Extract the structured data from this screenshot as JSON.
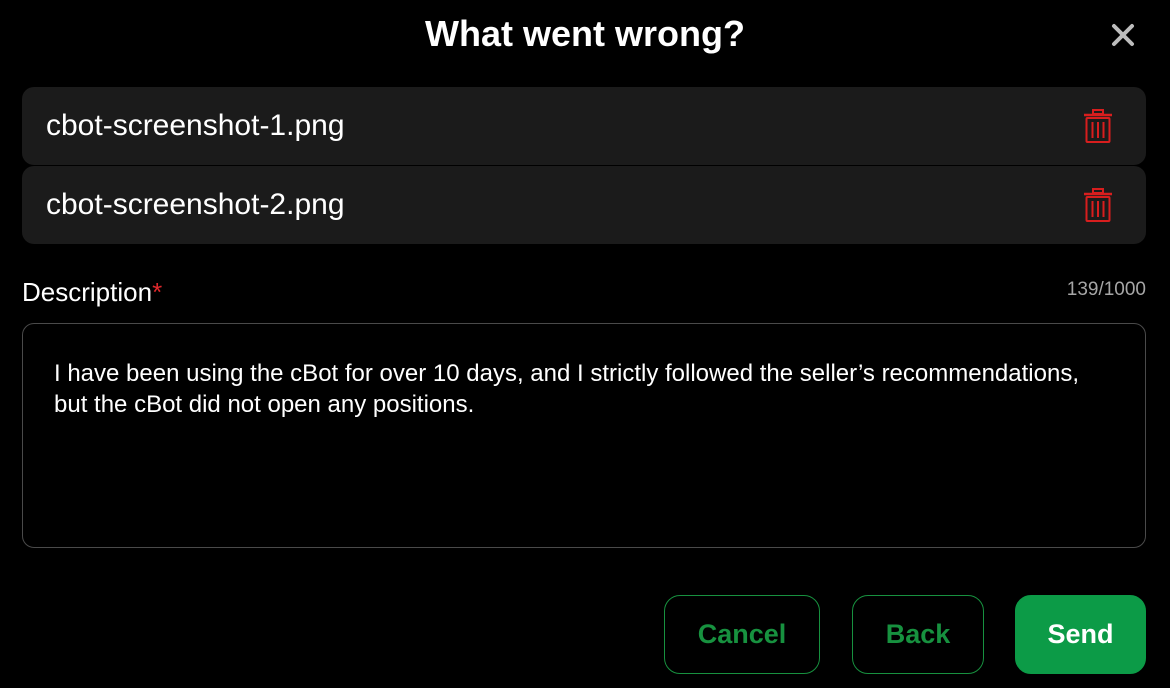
{
  "dialog": {
    "title": "What went wrong?",
    "close_icon": "close-icon"
  },
  "attachments": [
    {
      "file_name": "cbot-screenshot-1.png",
      "delete_icon": "trash-icon"
    },
    {
      "file_name": "cbot-screenshot-2.png",
      "delete_icon": "trash-icon"
    }
  ],
  "description": {
    "label": "Description",
    "required_marker": "*",
    "counter": "139/1000",
    "value": "I have been using the cBot for over 10 days, and I strictly followed the seller’s recommendations, but the cBot did not open any positions."
  },
  "actions": {
    "cancel_label": "Cancel",
    "back_label": "Back",
    "send_label": "Send"
  },
  "colors": {
    "background": "#000000",
    "row_background": "#1b1b1b",
    "accent_green": "#0c9b47",
    "delete_red": "#d81e1e",
    "required_red": "#e0282c",
    "muted_text": "#a6a6a6"
  }
}
